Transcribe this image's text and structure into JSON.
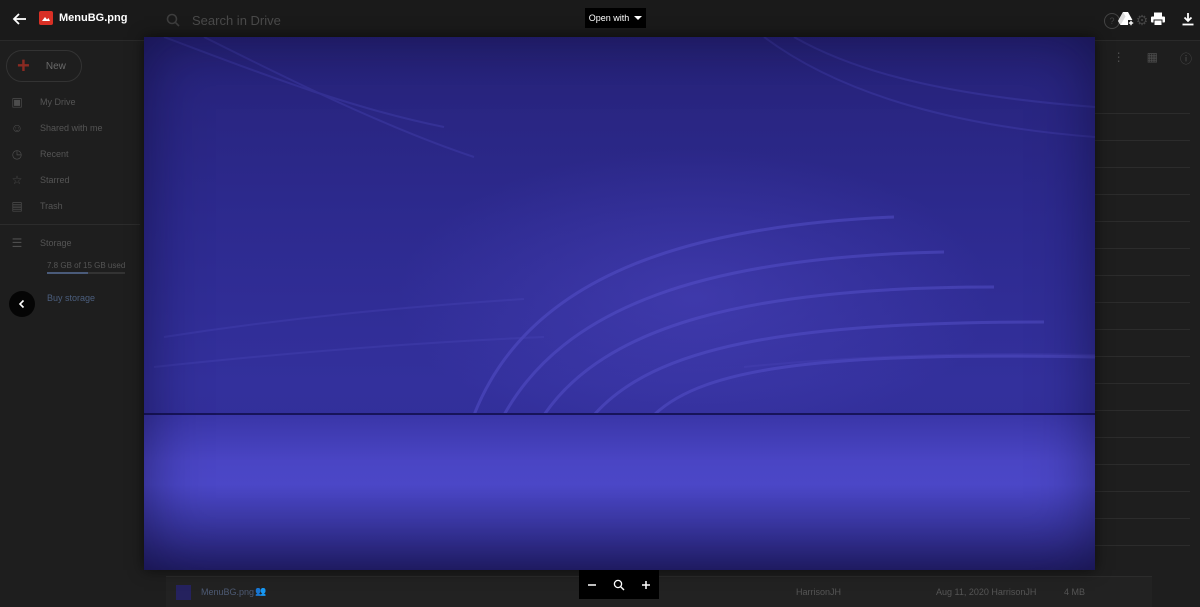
{
  "viewer": {
    "file_name": "MenuBG.png",
    "open_with_label": "Open with"
  },
  "drive": {
    "search_placeholder": "Search in Drive",
    "new_label": "New",
    "nav": [
      {
        "label": "My Drive",
        "icon": "drive-icon"
      },
      {
        "label": "Shared with me",
        "icon": "people-icon"
      },
      {
        "label": "Recent",
        "icon": "clock-icon"
      },
      {
        "label": "Starred",
        "icon": "star-icon"
      },
      {
        "label": "Trash",
        "icon": "trash-icon"
      }
    ],
    "storage_label": "Storage",
    "storage_used_text": "7.8 GB of 15 GB used",
    "storage_used_fraction": 0.52,
    "buy_storage_label": "Buy storage",
    "file_row": {
      "name": "MenuBG.png",
      "owner": "HarrisonJH",
      "modified": "Aug 11, 2020 HarrisonJH",
      "size": "4 MB"
    }
  },
  "colors": {
    "preview_purple": "#2d2a8f",
    "file_type_red": "#d93025",
    "overlay_dark": "#1c1c1c"
  }
}
